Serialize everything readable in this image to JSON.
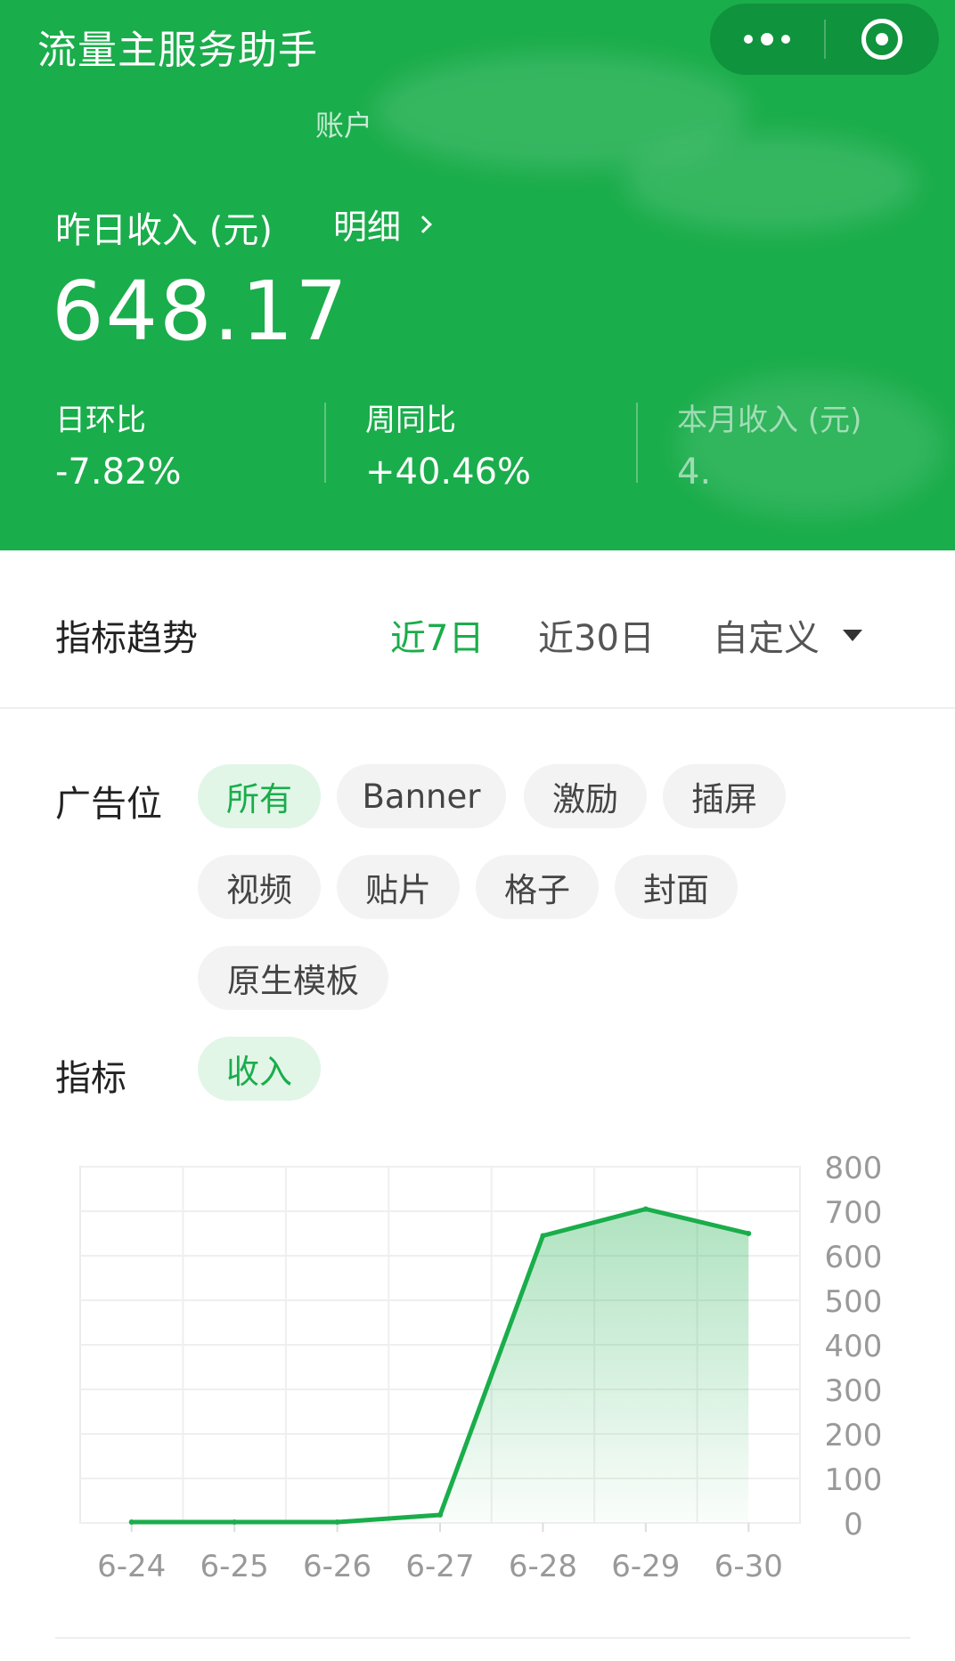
{
  "header": {
    "app_title": "流量主服务助手",
    "account_label": "账户",
    "income_label": "昨日收入 (元)",
    "detail_link": "明细",
    "income_value": "648.17",
    "stats": [
      {
        "label": "日环比",
        "value": "-7.82%"
      },
      {
        "label": "周同比",
        "value": "+40.46%"
      },
      {
        "label": "本月收入 (元)",
        "value": "4."
      }
    ],
    "colors": {
      "brand_green": "#1aad4b",
      "capsule": "#10933d"
    },
    "capsule_icons": [
      "more-dots-icon",
      "close-target-icon"
    ]
  },
  "trend": {
    "title": "指标趋势",
    "ranges": [
      {
        "label": "近7日",
        "active": true
      },
      {
        "label": "近30日",
        "active": false
      },
      {
        "label": "自定义",
        "active": false
      }
    ]
  },
  "filters": {
    "ad_slot_label": "广告位",
    "ad_slots": [
      {
        "label": "所有",
        "active": true
      },
      {
        "label": "Banner",
        "active": false
      },
      {
        "label": "激励",
        "active": false
      },
      {
        "label": "插屏",
        "active": false
      },
      {
        "label": "视频",
        "active": false
      },
      {
        "label": "贴片",
        "active": false
      },
      {
        "label": "格子",
        "active": false
      },
      {
        "label": "封面",
        "active": false
      },
      {
        "label": "原生模板",
        "active": false
      }
    ],
    "metric_label": "指标",
    "metrics": [
      {
        "label": "收入",
        "active": true
      }
    ]
  },
  "chart_data": {
    "type": "area",
    "categories": [
      "6-24",
      "6-25",
      "6-26",
      "6-27",
      "6-28",
      "6-29",
      "6-30"
    ],
    "series": [
      {
        "values": [
          2,
          2,
          2,
          18,
          645,
          705,
          650
        ]
      }
    ],
    "ylim": [
      0,
      800
    ],
    "yticks": [
      0,
      100,
      200,
      300,
      400,
      500,
      600,
      700,
      800
    ],
    "y_axis_position": "right",
    "grid": true,
    "line_color": "#1aad4b"
  }
}
